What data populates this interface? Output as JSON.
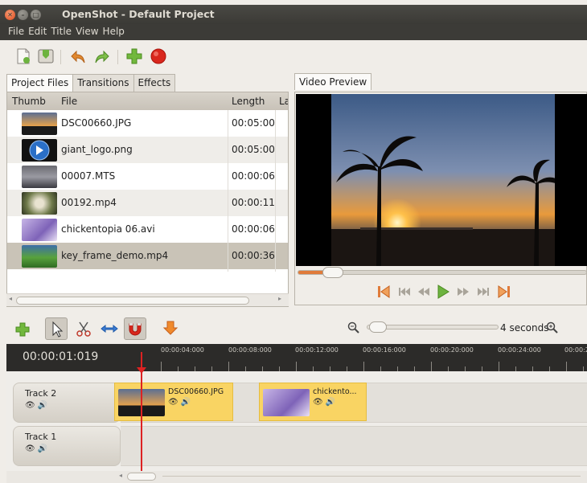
{
  "window": {
    "title": "OpenShot - Default Project"
  },
  "menu": [
    "File",
    "Edit",
    "Title",
    "View",
    "Help"
  ],
  "toolbar": {
    "icons": [
      "new-project-icon",
      "save-project-icon",
      "undo-icon",
      "redo-icon",
      "import-files-icon",
      "export-video-icon"
    ]
  },
  "panel": {
    "tabs": [
      "Project Files",
      "Transitions",
      "Effects"
    ],
    "active_tab": "Project Files",
    "columns": [
      "Thumb",
      "File",
      "Length",
      "La"
    ]
  },
  "files": [
    {
      "name": "DSC00660.JPG",
      "length": "00:05:00"
    },
    {
      "name": "giant_logo.png",
      "length": "00:05:00"
    },
    {
      "name": "00007.MTS",
      "length": "00:00:06"
    },
    {
      "name": "00192.mp4",
      "length": "00:00:11"
    },
    {
      "name": "chickentopia 06.avi",
      "length": "00:00:06"
    },
    {
      "name": "key_frame_demo.mp4",
      "length": "00:00:36"
    }
  ],
  "selected_file": "key_frame_demo.mp4",
  "preview": {
    "tab": "Video Preview",
    "seek_fraction": 0.12
  },
  "player_icons": [
    "jump-start-icon",
    "previous-marker-icon",
    "rewind-icon",
    "play-icon",
    "fast-forward-icon",
    "next-marker-icon",
    "jump-end-icon"
  ],
  "timeline": {
    "tool_icons": [
      "add-track-icon",
      "select-tool-icon",
      "razor-tool-icon",
      "resize-tool-icon",
      "snap-magnet-icon",
      "add-marker-icon"
    ],
    "zoom_label": "4 seconds",
    "timecode": "00:00:01:019",
    "ticks": [
      "00:00:04:000",
      "00:00:08:000",
      "00:00:12:000",
      "00:00:16:000",
      "00:00:20:000",
      "00:00:24:000",
      "00:00:2"
    ],
    "tracks": [
      {
        "name": "Track 2",
        "clips": [
          {
            "label": "DSC00660.JPG"
          },
          {
            "label": "chickento..."
          }
        ]
      },
      {
        "name": "Track 1",
        "clips": []
      }
    ],
    "toggle_glyphs": "👁 🔊"
  },
  "colors": {
    "title_bar": "#3c3b37",
    "clip": "#f9d463",
    "playhead": "#dd2222",
    "accent_orange": "#e07b3a"
  }
}
